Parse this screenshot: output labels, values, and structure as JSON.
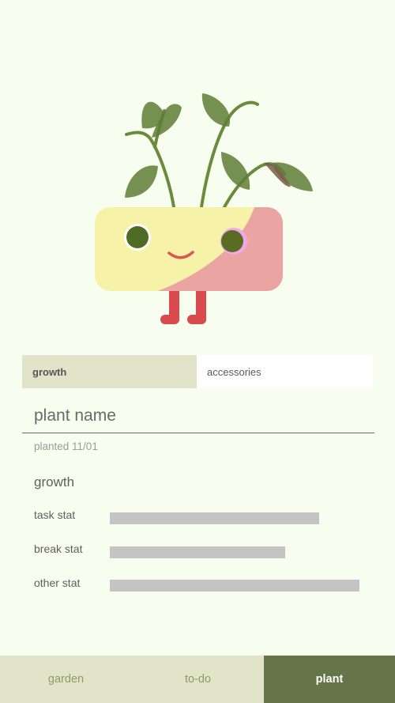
{
  "tabs": [
    {
      "label": "growth",
      "active": true
    },
    {
      "label": "accessories",
      "active": false
    }
  ],
  "plant": {
    "name_placeholder": "plant name",
    "planted": "planted 11/01"
  },
  "growth": {
    "heading": "growth",
    "stats": [
      {
        "label": "task stat",
        "value": 0.79
      },
      {
        "label": "break stat",
        "value": 0.66
      },
      {
        "label": "other stat",
        "value": 0.94
      }
    ]
  },
  "nav": {
    "items": [
      {
        "label": "garden",
        "active": false
      },
      {
        "label": "to-do",
        "active": false
      },
      {
        "label": "plant",
        "active": true
      }
    ]
  },
  "colors": {
    "background": "#f7fdef",
    "tab_active": "#e1e4c9",
    "nav_active": "#66744a",
    "bar": "#c4c4c4",
    "pot_yellow": "#f6f3a9",
    "pot_pink": "#eaa5a2",
    "leaf": "#5f7d35"
  },
  "illustration": "plant-character"
}
